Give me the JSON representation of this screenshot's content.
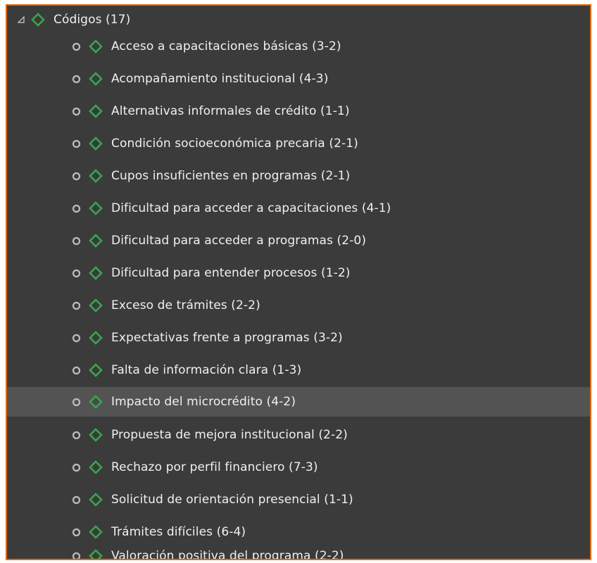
{
  "icons": {
    "root_expander": "collapse-triangle-icon",
    "code": "green-diamond-icon",
    "bullet": "circle-bullet-icon"
  },
  "colors": {
    "panel_bg": "#3b3b3b",
    "selected_row": "#535353",
    "diamond": "#39a54a",
    "border": "#e06a10",
    "text": "#f0f0f0"
  },
  "tree": {
    "root": {
      "label": "Códigos (17)"
    },
    "items": [
      {
        "label": "Acceso a capacitaciones básicas (3-2)"
      },
      {
        "label": "Acompañamiento institucional (4-3)"
      },
      {
        "label": "Alternativas informales de crédito (1-1)"
      },
      {
        "label": "Condición socioeconómica precaria (2-1)"
      },
      {
        "label": "Cupos insuficientes en programas (2-1)"
      },
      {
        "label": "Dificultad para acceder a capacitaciones (4-1)"
      },
      {
        "label": "Dificultad para acceder a programas (2-0)"
      },
      {
        "label": "Dificultad para entender procesos (1-2)"
      },
      {
        "label": "Exceso de trámites (2-2)"
      },
      {
        "label": "Expectativas frente a programas (3-2)"
      },
      {
        "label": "Falta de información clara (1-3)"
      },
      {
        "label": "Impacto del microcrédito (4-2)"
      },
      {
        "label": "Propuesta de mejora institucional (2-2)"
      },
      {
        "label": "Rechazo por perfil financiero (7-3)"
      },
      {
        "label": "Solicitud de orientación presencial (1-1)"
      },
      {
        "label": "Trámites difíciles (6-4)"
      },
      {
        "label": "Valoración positiva del programa (2-2)"
      }
    ]
  }
}
